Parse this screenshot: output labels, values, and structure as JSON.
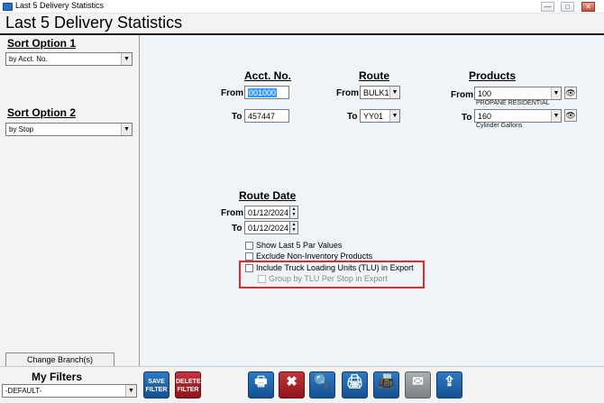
{
  "window": {
    "title": "Last 5 Delivery Statistics",
    "min_label": "—",
    "max_label": "□",
    "close_label": "✕"
  },
  "header": {
    "title": "Last 5 Delivery Statistics"
  },
  "sort1": {
    "label": "Sort Option 1",
    "value": "by Acct. No."
  },
  "sort2": {
    "label": "Sort Option 2",
    "value": "by Stop"
  },
  "change_branch_label": "Change Branch(s)",
  "acct": {
    "heading": "Acct. No.",
    "from_label": "From",
    "from_value": "001000",
    "to_label": "To",
    "to_value": "457447"
  },
  "route": {
    "heading": "Route",
    "from_label": "From",
    "from_value": "BULK1",
    "to_label": "To",
    "to_value": "YY01"
  },
  "products": {
    "heading": "Products",
    "from_label": "From",
    "from_value": "100",
    "from_desc": "PROPANE RESIDENTIAL",
    "to_label": "To",
    "to_value": "160",
    "to_desc": "Cylinder Gallons"
  },
  "route_date": {
    "heading": "Route Date",
    "from_label": "From",
    "from_value": "01/12/2024",
    "to_label": "To",
    "to_value": "01/12/2024"
  },
  "options": {
    "show_last5": "Show Last 5 Par Values",
    "exclude_noninv": "Exclude Non-Inventory Products",
    "include_tlu": "Include Truck Loading Units (TLU) in Export",
    "group_tlu": "Group by TLU Per Stop in Export"
  },
  "filters": {
    "label": "My Filters",
    "value": "-DEFAULT-",
    "save_label": "SAVE FILTER",
    "delete_label": "DELETE FILTER"
  },
  "icons": {
    "arrow": "▼",
    "spin_up": "▲",
    "spin_down": "▼",
    "binoculars": "👁",
    "print": "🖶",
    "cancel": "✖",
    "search": "🔍",
    "print_help": "🖨",
    "fax": "📠",
    "email": "✉",
    "export": "⇪"
  },
  "colors": {
    "accent_blue": "#2e7ac4",
    "accent_red": "#c4333a",
    "highlight": "#e0282f",
    "selection": "#3297fd"
  }
}
